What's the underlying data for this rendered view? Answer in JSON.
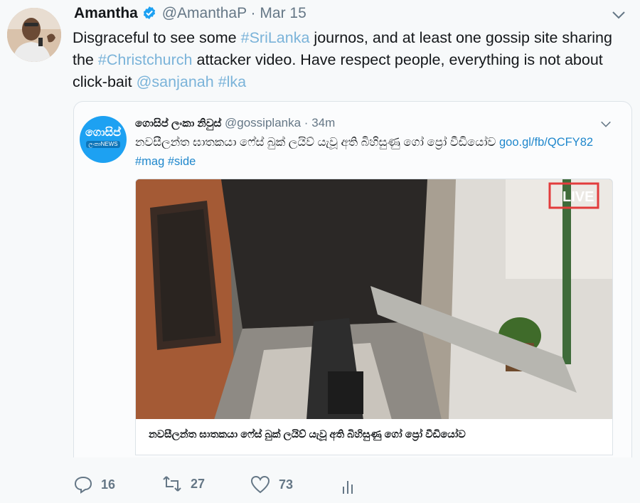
{
  "tweet": {
    "author_name": "Amantha",
    "author_handle": "@AmanthaP",
    "separator": "·",
    "date": "Mar 15",
    "text_parts": [
      {
        "t": "Disgraceful to see some ",
        "link": false
      },
      {
        "t": "#SriLanka",
        "link": true
      },
      {
        "t": " journos, and at least one gossip site sharing the ",
        "link": false
      },
      {
        "t": "#Christchurch",
        "link": true
      },
      {
        "t": " attacker video. Have respect people, everything is not about click-bait ",
        "link": false
      },
      {
        "t": "@sanjanah",
        "link": true
      },
      {
        "t": " ",
        "link": false
      },
      {
        "t": "#lka",
        "link": true
      }
    ],
    "icons": {
      "verified": "verified-badge-icon",
      "menu": "chevron-down-icon"
    },
    "link_color": "#7ab3d9"
  },
  "quoted": {
    "author_name": "ගොසිප් ලංකා නිවුස්",
    "author_handle": "@gossiplanka",
    "separator": "·",
    "time": "34m",
    "avatar_logo_top": "ගොසිප්",
    "avatar_logo_bottom": "ලංකාNEWS",
    "text": "නවසීලන්ත ඝාතකයා ෆේස් බුක් ලයිව් යැවූ අති බිහිසුණු ගෝ ප්‍රෝ වීඩියෝව",
    "url": "goo.gl/fb/QCFY82",
    "hashtags": "#mag #side",
    "media_caption": "නවසීලන්ත ඝාතකයා ෆේස් බුක් ලයිව් යැවූ අති බිහිසුණු ගෝ ප්‍රෝ වීඩියෝව",
    "media_overlay": "LIVE",
    "link_color": "#1f87cc"
  },
  "actions": {
    "reply_count": "16",
    "retweet_count": "27",
    "like_count": "73",
    "icons": [
      "reply-icon",
      "retweet-icon",
      "like-icon",
      "analytics-icon"
    ]
  }
}
